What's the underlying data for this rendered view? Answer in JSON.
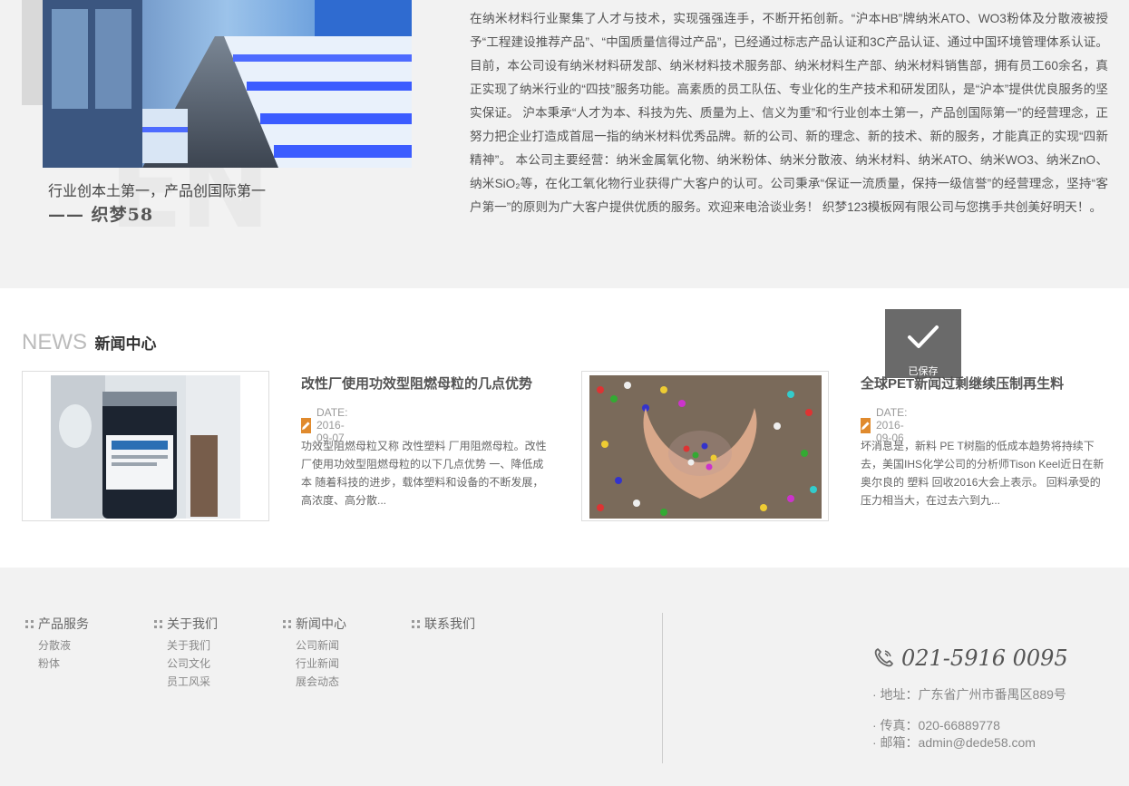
{
  "about": {
    "quote": "行业创本土第一，产品创国际第一",
    "signature": "—— 织梦58",
    "bg_watermark": "EN",
    "body": "在纳米材料行业聚集了人才与技术，实现强强连手，不断开拓创新。“沪本HB”牌纳米ATO、WO3粉体及分散液被授予“工程建设推荐产品”、“中国质量信得过产品”，已经通过标志产品认证和3C产品认证、通过中国环境管理体系认证。 目前，本公司设有纳米材料研发部、纳米材料技术服务部、纳米材料生产部、纳米材料销售部，拥有员工60余名，真正实现了纳米行业的“四技”服务功能。高素质的员工队伍、专业化的生产技术和研发团队，是“沪本”提供优良服务的坚实保证。 沪本秉承“人才为本、科技为先、质量为上、信义为重”和“行业创本土第一，产品创国际第一”的经营理念，正努力把企业打造成首屈一指的纳米材料优秀品牌。新的公司、新的理念、新的技术、新的服务，才能真正的实现“四新精神”。 本公司主要经营：纳米金属氧化物、纳米粉体、纳米分散液、纳米材料、纳米ATO、纳米WO3、纳米ZnO、纳米SiO₂等，在化工氧化物行业获得广大客户的认可。公司秉承“保证一流质量，保持一级信誉”的经营理念，坚持“客户第一”的原则为广大客户提供优质的服务。欢迎来电洽谈业务！ 织梦123模板网有限公司与您携手共创美好明天！。"
  },
  "news": {
    "heading_en": "NEWS",
    "heading_cn": "新闻中心",
    "items": [
      {
        "title": "改性厂使用功效型阻燃母粒的几点优势",
        "date": "DATE: 2016-09-07",
        "summary": "功效型阻燃母粒又称 改性塑料 厂用阻燃母粒。改性厂使用功效型阻燃母粒的以下几点优势 一、降低成本 随着科技的进步，载体塑料和设备的不断发展，高浓度、高分散..."
      },
      {
        "title": "全球PET新闻过剩继续压制再生料",
        "date": "DATE: 2016-09-06",
        "summary": "坏消息是，新料 PE T树脂的低成本趋势将持续下去，美国IHS化学公司的分析师Tison Keel近日在新奥尔良的 塑料 回收2016大会上表示。 回料承受的压力相当大，在过去六到九..."
      }
    ],
    "saved_toast": "已保存"
  },
  "footer": {
    "columns": [
      {
        "title": "产品服务",
        "links": [
          "分散液",
          "粉体"
        ]
      },
      {
        "title": "关于我们",
        "links": [
          "关于我们",
          "公司文化",
          "员工风采"
        ]
      },
      {
        "title": "新闻中心",
        "links": [
          "公司新闻",
          "行业新闻",
          "展会动态"
        ]
      },
      {
        "title": "联系我们",
        "links": []
      }
    ],
    "phone": "021-5916 0095",
    "address": "· 地址：广东省广州市番禺区889号",
    "fax": "· 传真：020-66889778",
    "email": "· 邮箱：admin@dede58.com"
  },
  "colors": {
    "accent_orange": "#e08a2d",
    "section_bg": "#f2f2f2"
  }
}
